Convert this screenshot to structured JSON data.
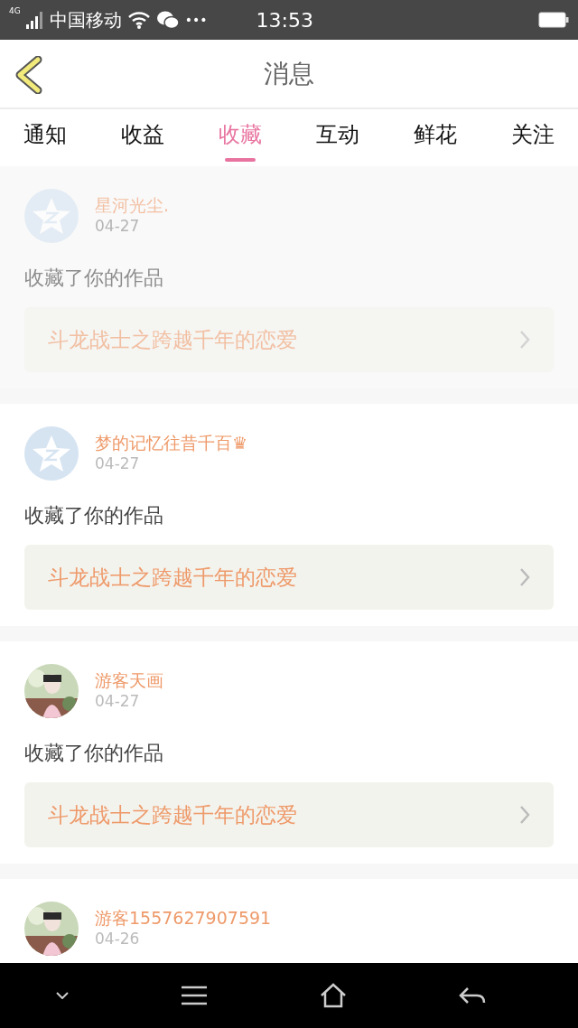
{
  "status_bar": {
    "network": "4G",
    "carrier": "中国移动",
    "dots": "•••",
    "time": "13:53"
  },
  "header": {
    "title": "消息"
  },
  "tabs": [
    {
      "label": "通知",
      "selected": false
    },
    {
      "label": "收益",
      "selected": false
    },
    {
      "label": "收藏",
      "selected": true
    },
    {
      "label": "互动",
      "selected": false
    },
    {
      "label": "鲜花",
      "selected": false
    },
    {
      "label": "关注",
      "selected": false
    }
  ],
  "messages": [
    {
      "faded": true,
      "avatar": {
        "kind": "default"
      },
      "user": "星河光尘.",
      "date": "04-27",
      "text": "收藏了你的作品",
      "work": "斗龙战士之跨越千年的恋爱"
    },
    {
      "faded": false,
      "avatar": {
        "kind": "default"
      },
      "user": "梦的记忆往昔千百♛",
      "date": "04-27",
      "text": "收藏了你的作品",
      "work": "斗龙战士之跨越千年的恋爱"
    },
    {
      "faded": false,
      "user": "游客天画",
      "date": "04-27",
      "text": "收藏了你的作品",
      "work": "斗龙战士之跨越千年的恋爱"
    },
    {
      "faded": false,
      "user": "游客1557627907591",
      "date": "04-26"
    }
  ]
}
